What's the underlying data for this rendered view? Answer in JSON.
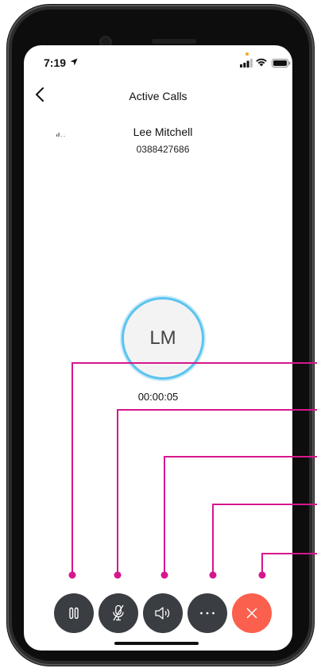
{
  "status_bar": {
    "time": "7:19"
  },
  "header": {
    "title": "Active Calls"
  },
  "caller": {
    "name": "Lee Mitchell",
    "number": "0388427686",
    "initials": "LM",
    "duration": "00:00:05"
  },
  "controls": [
    {
      "id": "hold",
      "icon": "pause-icon"
    },
    {
      "id": "mute",
      "icon": "microphone-muted-icon"
    },
    {
      "id": "speaker",
      "icon": "speaker-icon"
    },
    {
      "id": "more",
      "icon": "more-icon"
    },
    {
      "id": "end",
      "icon": "close-icon"
    }
  ],
  "colors": {
    "avatar_ring": "#5bc4ef",
    "control_bg": "#3a3d41",
    "end_call": "#fb5f4d",
    "callout": "#d6178c"
  }
}
